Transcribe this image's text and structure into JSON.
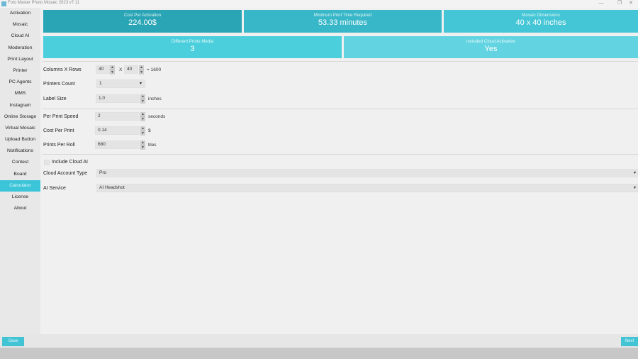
{
  "window": {
    "title": "Foto Master Photo Mosaic 2023 v7.11",
    "minimize": "—",
    "maximize": "❐",
    "close": "✕"
  },
  "sidebar": {
    "items": [
      {
        "label": "Activation"
      },
      {
        "label": "Mosaic"
      },
      {
        "label": "Cloud AI"
      },
      {
        "label": "Moderation"
      },
      {
        "label": "Print Layout"
      },
      {
        "label": "Printer"
      },
      {
        "label": "PC Agents"
      },
      {
        "label": "MMS"
      },
      {
        "label": "Instagram"
      },
      {
        "label": "Online Storage"
      },
      {
        "label": "Virtual Mosaic"
      },
      {
        "label": "Upload Button"
      },
      {
        "label": "Notifications"
      },
      {
        "label": "Contest"
      },
      {
        "label": "Board"
      },
      {
        "label": "Calculator"
      },
      {
        "label": "License"
      },
      {
        "label": "About"
      }
    ],
    "active_index": 15
  },
  "summary_cards": [
    {
      "label": "Cost Per Activation",
      "value": "224.00$"
    },
    {
      "label": "Minimum Print Time Required",
      "value": "53.33 minutes"
    },
    {
      "label": "Mosaic Dimensions",
      "value": "40 x 40 inches"
    },
    {
      "label": "Different Prints Media",
      "value": "3"
    },
    {
      "label": "Included Cloud Activation",
      "value": "Yes"
    }
  ],
  "form": {
    "columns_rows_label": "Columns X Rows",
    "columns_value": "40",
    "x_separator": "X",
    "rows_value": "40",
    "total_text": "= 1600",
    "printers_count_label": "Printers Count",
    "printers_count_value": "1",
    "label_size_label": "Label Size",
    "label_size_value": "1.0",
    "label_size_unit": "inches",
    "per_print_speed_label": "Per Print Speed",
    "per_print_speed_value": "2",
    "per_print_speed_unit": "seconds",
    "cost_per_print_label": "Cost Per Print",
    "cost_per_print_value": "0.14",
    "cost_per_print_unit": "$",
    "prints_per_roll_label": "Prints Per Roll",
    "prints_per_roll_value": "680",
    "prints_per_roll_unit": "tiles",
    "include_cloud_ai_label": "Include Cloud AI",
    "cloud_account_type_label": "Cloud Account Type",
    "cloud_account_type_value": "Pro",
    "ai_service_label": "AI Service",
    "ai_service_value": "AI Headshot"
  },
  "buttons": {
    "save": "Save",
    "right": "Next"
  },
  "colors": {
    "accent": "#3cc4d8",
    "card_dark": "#2aa5b5",
    "card_light": "#62d4e1"
  }
}
